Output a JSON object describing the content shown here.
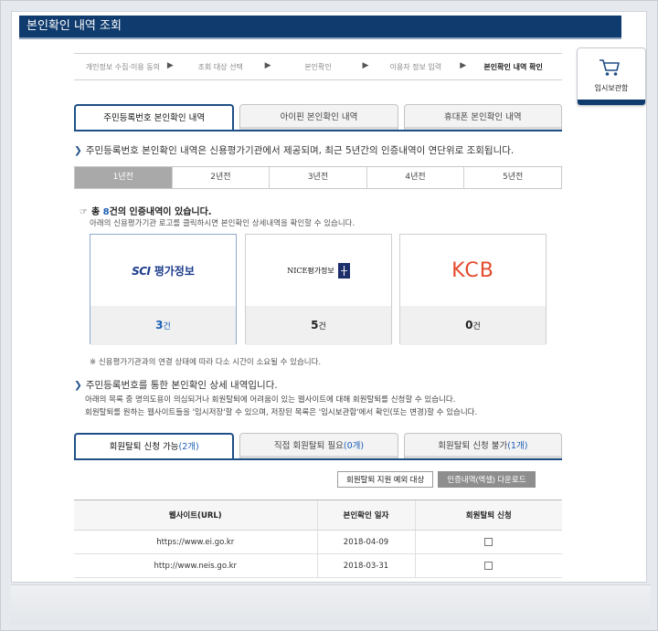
{
  "title": "본인확인 내역 조회",
  "steps": [
    {
      "label": "개인정보 수집·이용 동의",
      "active": false
    },
    {
      "label": "조회 대상 선택",
      "active": false
    },
    {
      "label": "본인확인",
      "active": false
    },
    {
      "label": "이용자 정보 입력",
      "active": false
    },
    {
      "label": "본인확인 내역 확인",
      "active": true
    }
  ],
  "cart": {
    "label": "임시보관함",
    "icon": "shopping-cart-icon"
  },
  "id_tabs": [
    {
      "label": "주민등록번호 본인확인 내역",
      "active": true
    },
    {
      "label": "아이핀 본인확인 내역",
      "active": false
    },
    {
      "label": "휴대폰 본인확인 내역",
      "active": false
    }
  ],
  "id_desc": "주민등록번호 본인확인 내역은 신용평가기관에서 제공되며, 최근 5년간의 인증내역이 연단위로 조회됩니다.",
  "years": [
    {
      "label": "1년전",
      "active": true
    },
    {
      "label": "2년전",
      "active": false
    },
    {
      "label": "3년전",
      "active": false
    },
    {
      "label": "4년전",
      "active": false
    },
    {
      "label": "5년전",
      "active": false
    }
  ],
  "total": {
    "prefix": "총 ",
    "count": "8",
    "suffix": "건의 인증내역이 있습니다.",
    "hand_icon": "☞"
  },
  "total_sub": "아래의 신용평가기관 로고를 클릭하시면 본인확인 상세내역을 확인할 수 있습니다.",
  "agencies": {
    "sci": {
      "logo_a": "SCI",
      "logo_b": "평가정보",
      "count": "3",
      "unit": "건"
    },
    "nice": {
      "logo": "NICE평가정보",
      "count": "5",
      "unit": "건"
    },
    "kcb": {
      "logo": "KCB",
      "count": "0",
      "unit": "건"
    }
  },
  "notice": "※ 신용평가기관과의 연결 상태에 따라 다소 시간이 소요될 수 있습니다.",
  "detail_desc": "주민등록번호를 통한 본인확인 상세 내역입니다.",
  "detail_sub1": "아래의 목록 중 명의도용이 의심되거나 회원탈퇴에 어려움이 있는 웹사이트에 대해 회원탈퇴를 신청할 수 있습니다.",
  "detail_sub2": "회원탈퇴를 원하는 웹사이트들을 '임시저장'할 수 있으며, 저장된 목록은 '임시보관함'에서 확인(또는 변경)할 수 있습니다.",
  "withdraw_tabs": [
    {
      "label": "회원탈퇴 신청 가능",
      "count": "(2개)",
      "active": true
    },
    {
      "label": "직접 회원탈퇴 필요",
      "count": "(0개)",
      "active": false
    },
    {
      "label": "회원탈퇴 신청 불가",
      "count": "(1개)",
      "active": false
    }
  ],
  "buttons": {
    "exclude": "회원탈퇴 지원 예외 대상",
    "download": "인증내역(엑셀) 다운로드"
  },
  "table": {
    "headers": [
      "웹사이트(URL)",
      "본인확인 일자",
      "회원탈퇴 신청"
    ],
    "rows": [
      {
        "url": "https://www.ei.go.kr",
        "date": "2018-04-09",
        "checked": false
      },
      {
        "url": "http://www.neis.go.kr",
        "date": "2018-03-31",
        "checked": false
      }
    ]
  },
  "colors": {
    "navy": "#0f3b6e",
    "tab_border": "#1e4f86",
    "accent_blue": "#1a5fb4",
    "kcb_red": "#e44a2d"
  }
}
